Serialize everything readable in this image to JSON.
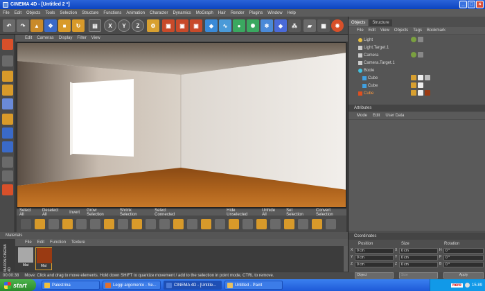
{
  "window": {
    "title": "CINEMA 4D - [Untitled 2 *]"
  },
  "menus": [
    "File",
    "Edit",
    "Objects",
    "Tools",
    "Selection",
    "Structure",
    "Functions",
    "Animation",
    "Character",
    "Dynamics",
    "MoGraph",
    "Hair",
    "Render",
    "Plugins",
    "Window",
    "Help"
  ],
  "toolbar": {
    "axis_x": "X",
    "axis_y": "Y",
    "axis_z": "Z"
  },
  "viewport_menu": [
    "Edit",
    "Cameras",
    "Display",
    "Filter",
    "View"
  ],
  "selection_tabs": [
    "Select All",
    "Deselect All",
    "Invert",
    "Grow Selection",
    "Shrink Selection",
    "Select Connected",
    "Hide Unselected",
    "Unhide All",
    "Set Selection",
    "Convert Selection"
  ],
  "materials": {
    "title": "Materials",
    "menu": [
      "File",
      "Edit",
      "Function",
      "Texture"
    ],
    "items": [
      {
        "label": "Mat",
        "color": "#a8a8a8"
      },
      {
        "label": "Mat",
        "color": "#9a3a12"
      }
    ]
  },
  "maxon_brand": "MAXON CINEMA 4D",
  "status": {
    "time": "00:00:38",
    "message": "Move: Click and drag to move elements. Hold down SHIFT to quantize movement / add to the selection in point mode, CTRL to remove."
  },
  "objects_panel": {
    "tabs": [
      "Objects",
      "Structure"
    ],
    "menu": [
      "File",
      "Edit",
      "View",
      "Objects",
      "Tags",
      "Bookmark"
    ],
    "rows": [
      {
        "name": "Light",
        "icon_color": "#e8c040",
        "indent": 0
      },
      {
        "name": "Light.Target.1",
        "icon_color": "#cccccc",
        "indent": 0
      },
      {
        "name": "Camera",
        "icon_color": "#cccccc",
        "indent": 0
      },
      {
        "name": "Camera.Target.1",
        "icon_color": "#cccccc",
        "indent": 0
      },
      {
        "name": "Boole",
        "icon_color": "#40c0e0",
        "indent": 0
      },
      {
        "name": "Cube",
        "icon_color": "#40a0e0",
        "indent": 1
      },
      {
        "name": "Cube",
        "icon_color": "#40a0e0",
        "indent": 1
      },
      {
        "name": "Cube",
        "icon_color": "#e05020",
        "indent": 0,
        "highlight": true
      }
    ]
  },
  "attributes_panel": {
    "title": "Attributes",
    "menu": [
      "Mode",
      "Edit",
      "User Data"
    ]
  },
  "coordinates_panel": {
    "title": "Coordinates",
    "columns": [
      "Position",
      "Size",
      "Rotation"
    ],
    "rows": [
      {
        "a1": "X",
        "v1": "0 cm",
        "a2": "X",
        "v2": "0 cm",
        "a3": "H",
        "v3": "0 °"
      },
      {
        "a1": "Y",
        "v1": "0 cm",
        "a2": "Y",
        "v2": "0 cm",
        "a3": "P",
        "v3": "0 °"
      },
      {
        "a1": "Z",
        "v1": "0 cm",
        "a2": "Z",
        "v2": "0 cm",
        "a3": "B",
        "v3": "0 °"
      }
    ],
    "mode_select": "Object",
    "size_select": "Size",
    "apply_label": "Apply"
  },
  "taskbar": {
    "start_label": "start",
    "items": [
      {
        "label": "Palestrina",
        "icon_color": "#f0c040",
        "active": false
      },
      {
        "label": "Leggi argomento - Se...",
        "icon_color": "#e07030",
        "active": false
      },
      {
        "label": "CINEMA 4D - [Untitle...",
        "icon_color": "#4a7ad8",
        "active": true
      },
      {
        "label": "Untitled - Paint",
        "icon_color": "#e8c060",
        "active": false
      }
    ],
    "tray_brand": "nero",
    "clock": "15.89"
  }
}
